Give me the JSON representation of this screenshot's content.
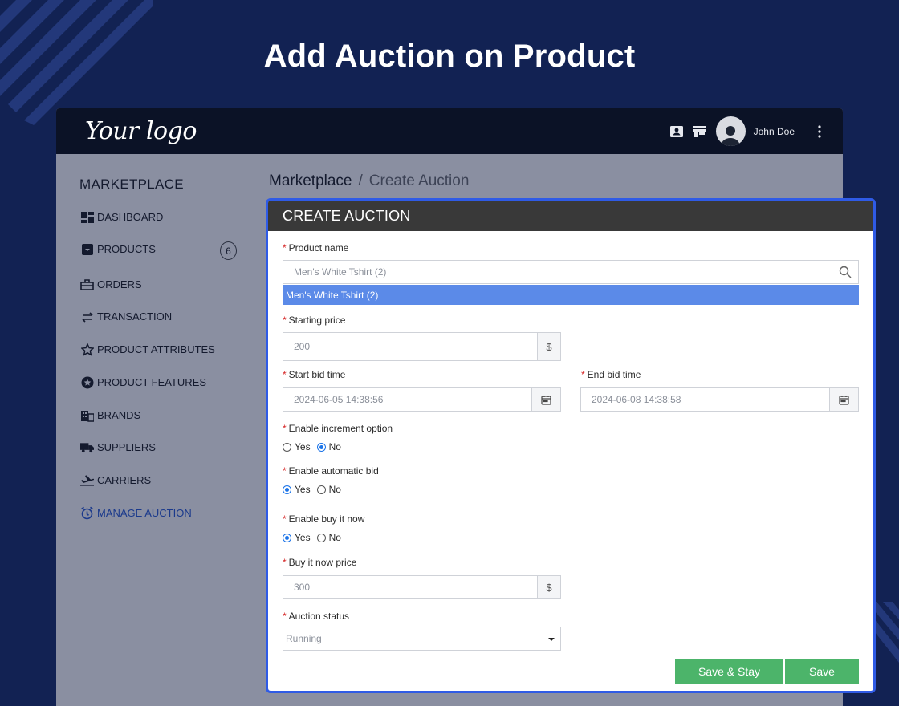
{
  "headline": "Add Auction on Product",
  "topbar": {
    "logo": "Your logo",
    "username": "John Doe"
  },
  "sidebar": {
    "title": "MARKETPLACE",
    "items": [
      {
        "label": "DASHBOARD",
        "icon": "dashboard-icon"
      },
      {
        "label": "PRODUCTS",
        "icon": "products-icon",
        "badge": "6"
      },
      {
        "label": "ORDERS",
        "icon": "orders-icon"
      },
      {
        "label": "TRANSACTION",
        "icon": "transaction-icon"
      },
      {
        "label": "PRODUCT ATTRIBUTES",
        "icon": "star-icon"
      },
      {
        "label": "PRODUCT FEATURES",
        "icon": "badge-star-icon"
      },
      {
        "label": "BRANDS",
        "icon": "building-icon"
      },
      {
        "label": "SUPPLIERS",
        "icon": "truck-icon"
      },
      {
        "label": "CARRIERS",
        "icon": "plane-icon"
      },
      {
        "label": "MANAGE AUCTION",
        "icon": "alarm-clock-icon",
        "active": true
      }
    ]
  },
  "breadcrumb": {
    "root": "Marketplace",
    "separator": "/",
    "current": "Create Auction"
  },
  "form": {
    "title": "CREATE AUCTION",
    "required_mark": "*",
    "product_name": {
      "label": "Product name",
      "value": "Men's White Tshirt (2)",
      "suggestion": "Men's White Tshirt (2)"
    },
    "starting_price": {
      "label": "Starting price",
      "value": "200",
      "addon": "$"
    },
    "start_bid_time": {
      "label": "Start bid time",
      "value": "2024-06-05 14:38:56"
    },
    "end_bid_time": {
      "label": "End bid time",
      "value": "2024-06-08 14:38:58"
    },
    "increment_option": {
      "label": "Enable increment option",
      "yes": "Yes",
      "no": "No",
      "selected": "No"
    },
    "automatic_bid": {
      "label": "Enable automatic bid",
      "yes": "Yes",
      "no": "No",
      "selected": "Yes"
    },
    "buy_it_now": {
      "label": "Enable buy it now",
      "yes": "Yes",
      "no": "No",
      "selected": "Yes"
    },
    "buy_it_now_price": {
      "label": "Buy it now price",
      "value": "300",
      "addon": "$"
    },
    "auction_status": {
      "label": "Auction status",
      "value": "Running"
    },
    "buttons": {
      "save_stay": "Save & Stay",
      "save": "Save"
    }
  },
  "colors": {
    "page_bg": "#122253",
    "accent": "#2f5be6",
    "suggestion_bg": "#5b8ae8",
    "button_green": "#4cb46a",
    "required": "#d62828"
  }
}
